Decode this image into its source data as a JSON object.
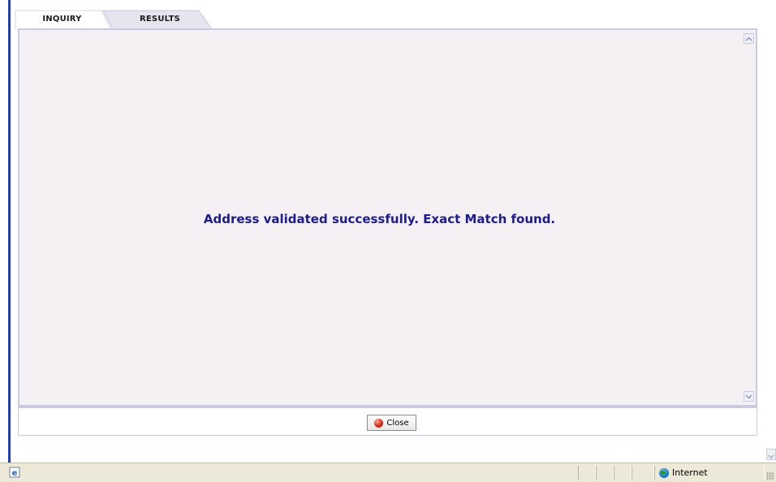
{
  "tabs": [
    {
      "label": "INQUIRY",
      "active": false
    },
    {
      "label": "RESULTS",
      "active": true
    }
  ],
  "content": {
    "message": "Address validated successfully. Exact Match found."
  },
  "footer": {
    "close_label": "Close"
  },
  "status_bar": {
    "zone_label": "Internet"
  },
  "colors": {
    "message_text": "#1c1c8e",
    "panel_background": "#f4f0f4",
    "accent_bar": "#1f3fb8",
    "status_bar": "#ece9d8"
  },
  "icons": [
    "ie-page-icon",
    "close-icon",
    "globe-icon",
    "scroll-up-icon",
    "scroll-down-icon",
    "resize-grip-icon"
  ]
}
